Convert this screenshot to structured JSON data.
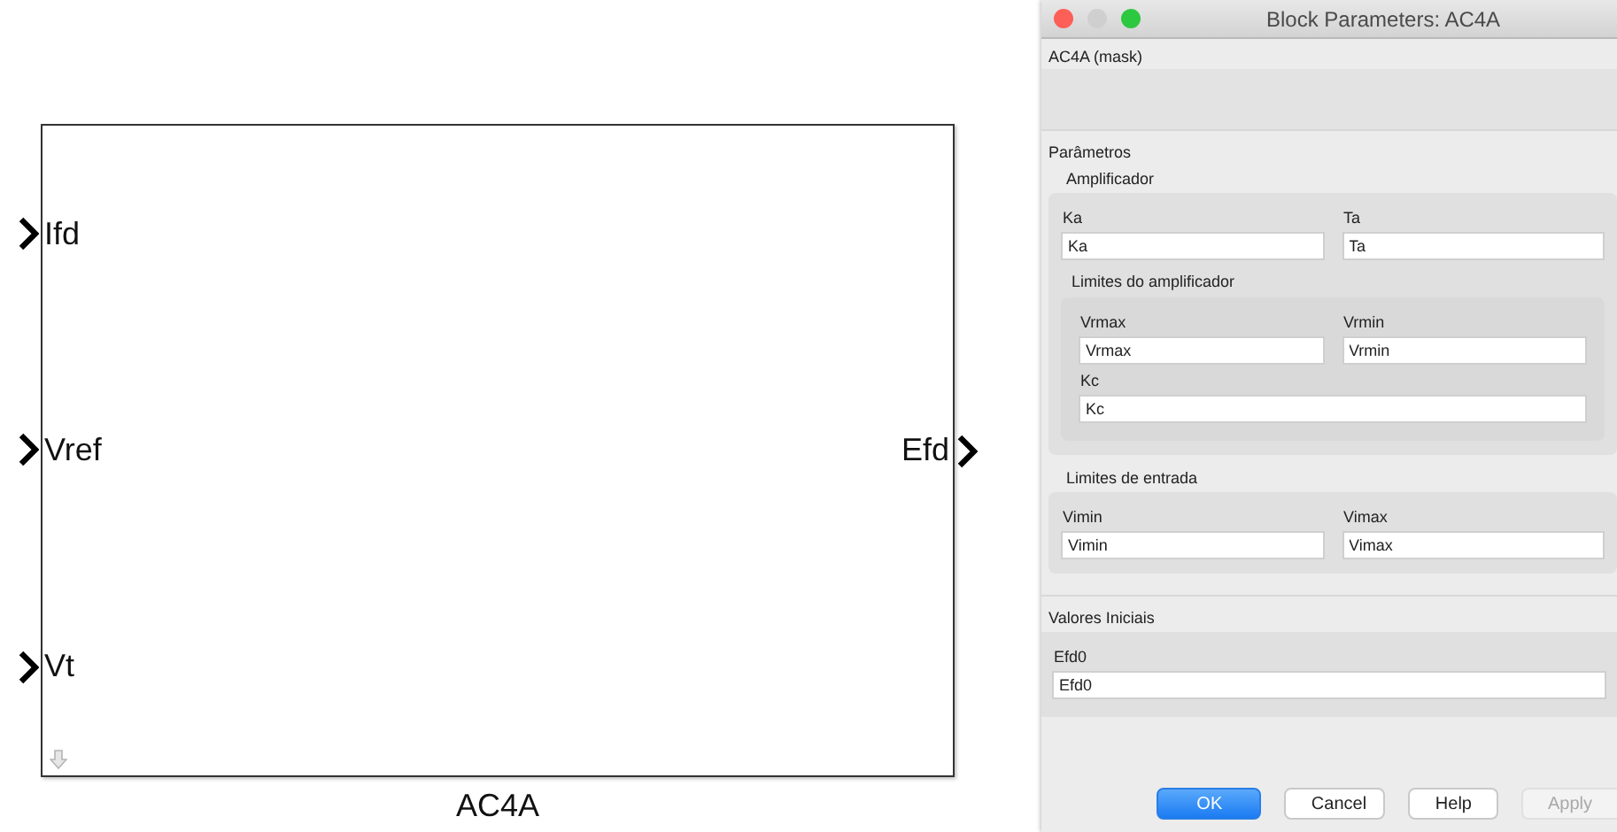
{
  "block": {
    "name": "AC4A",
    "inputs": [
      "Ifd",
      "Vref",
      "Vt"
    ],
    "outputs": [
      "Efd"
    ]
  },
  "dialog": {
    "title": "Block Parameters: AC4A",
    "mask_title": "AC4A (mask)",
    "sections": [
      {
        "title": "Parâmetros",
        "kind": "plain",
        "children": [
          {
            "kind": "group",
            "title": "Amplificador",
            "children": [
              {
                "kind": "row",
                "fields": [
                  {
                    "label": "Ka",
                    "value": "Ka"
                  },
                  {
                    "label": "Ta",
                    "value": "Ta"
                  }
                ]
              },
              {
                "kind": "group",
                "title": "Limites do amplificador",
                "children": [
                  {
                    "kind": "row",
                    "fields": [
                      {
                        "label": "Vrmax",
                        "value": "Vrmax"
                      },
                      {
                        "label": "Vrmin",
                        "value": "Vrmin"
                      }
                    ]
                  },
                  {
                    "kind": "row",
                    "fields": [
                      {
                        "label": "Kc",
                        "value": "Kc"
                      }
                    ]
                  }
                ]
              }
            ]
          },
          {
            "kind": "group",
            "title": "Limites de entrada",
            "children": [
              {
                "kind": "row",
                "fields": [
                  {
                    "label": "Vimin",
                    "value": "Vimin"
                  },
                  {
                    "label": "Vimax",
                    "value": "Vimax"
                  }
                ]
              }
            ]
          }
        ]
      },
      {
        "title": "Valores Iniciais",
        "kind": "boxed",
        "children": [
          {
            "kind": "row",
            "fields": [
              {
                "label": "Efd0",
                "value": "Efd0"
              }
            ]
          }
        ]
      }
    ],
    "buttons": [
      {
        "label": "OK",
        "kind": "primary",
        "disabled": false
      },
      {
        "label": "Cancel",
        "kind": "normal",
        "disabled": false
      },
      {
        "label": "Help",
        "kind": "normal",
        "disabled": false
      },
      {
        "label": "Apply",
        "kind": "normal",
        "disabled": true
      }
    ]
  }
}
